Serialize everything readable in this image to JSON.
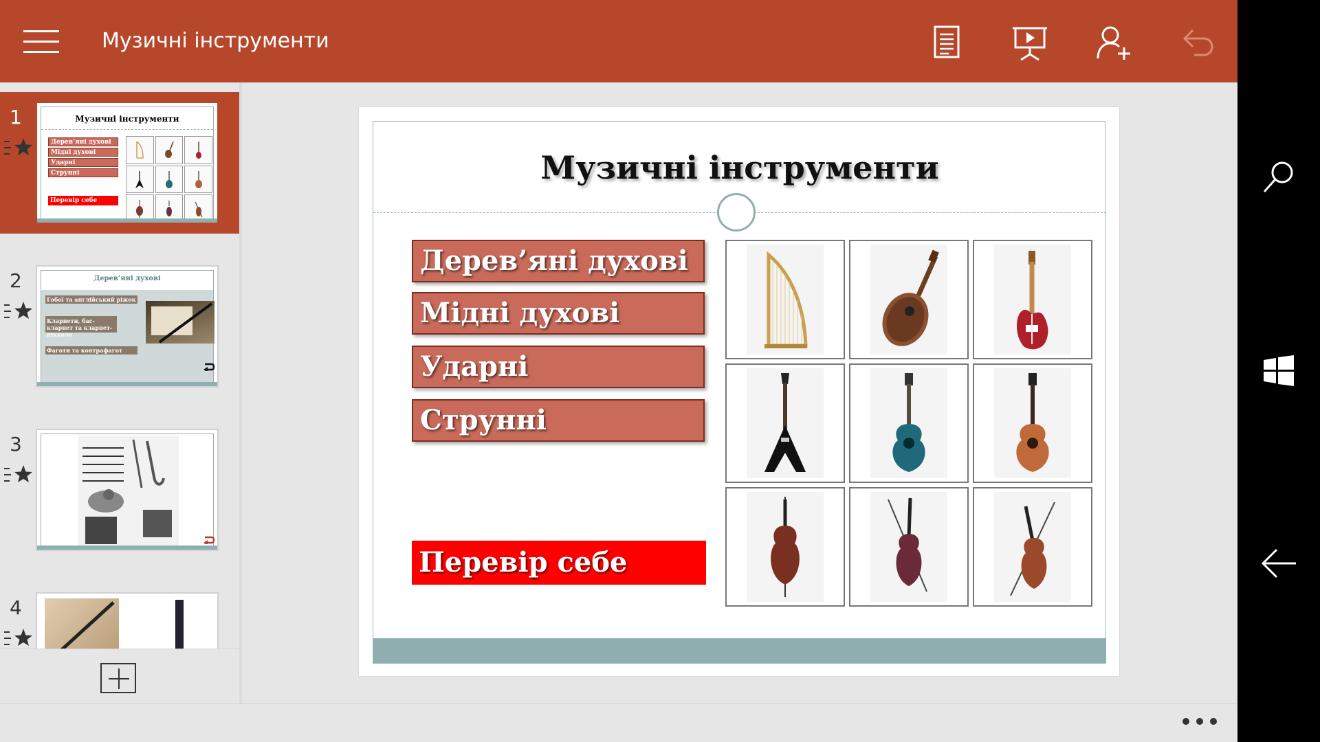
{
  "titlebar": {
    "title": "Музичні інструменти",
    "icons": [
      "menu-icon",
      "reading-view-icon",
      "present-icon",
      "share-icon",
      "undo-icon"
    ]
  },
  "slides": [
    {
      "number": "1",
      "title": "Музичні інструменти",
      "items": [
        "Дерев’яні духові",
        "Мідні духові",
        "Ударні",
        "Струнні"
      ],
      "check": "Перевір себе"
    },
    {
      "number": "2",
      "title": "Дерев’яні духові",
      "items": [
        "Гобої та англійський ріжок",
        "Кларнети, бас-кларнет та кларнет-пікколо",
        "Фаготи та контрафагот"
      ]
    },
    {
      "number": "3"
    },
    {
      "number": "4"
    }
  ],
  "current_slide": {
    "title": "Музичні інструменти",
    "categories": [
      "Дерев’яні духові",
      "Мідні духові",
      "Ударні",
      "Струнні"
    ],
    "check_button": "Перевір себе",
    "instruments": [
      "harp",
      "mandolin",
      "electric-bass",
      "flying-v-guitar",
      "acoustic-electric-guitar",
      "classical-guitar",
      "cello",
      "violin",
      "viola"
    ]
  },
  "colors": {
    "accent": "#b7472a",
    "box_fill": "#c96a5a",
    "check_red": "#ff0000",
    "footer_teal": "#8faeaf"
  },
  "navbar": {
    "icons": [
      "search-icon",
      "windows-icon",
      "back-icon"
    ]
  }
}
